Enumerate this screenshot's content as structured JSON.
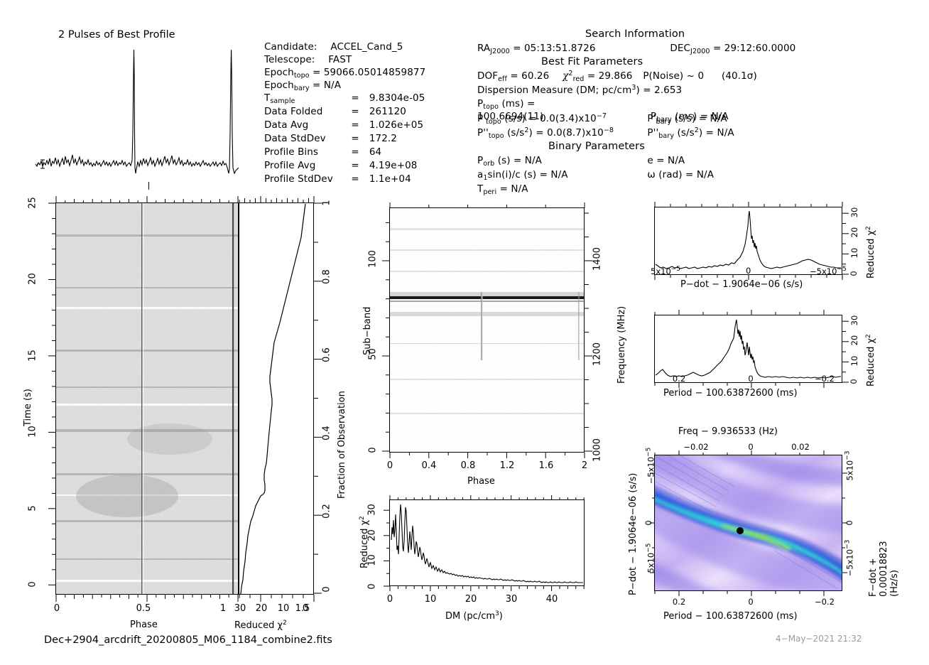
{
  "title_profile": "2 Pulses of Best Profile",
  "candidate_info": {
    "candidate_label": "Candidate:",
    "candidate_value": "ACCEL_Cand_5",
    "telescope_label": "Telescope:",
    "telescope_value": "FAST",
    "epoch_topo_label": "Epoch",
    "epoch_topo_sub": "topo",
    "epoch_topo_value": "59066.05014859877",
    "epoch_bary_label": "Epoch",
    "epoch_bary_sub": "bary",
    "epoch_bary_value": "N/A",
    "tsample_label": "T",
    "tsample_sub": "sample",
    "tsample_value": "9.8304e-05",
    "data_folded_label": "Data Folded",
    "data_folded_value": "261120",
    "data_avg_label": "Data Avg",
    "data_avg_value": "1.026e+05",
    "data_stddev_label": "Data StdDev",
    "data_stddev_value": "172.2",
    "profile_bins_label": "Profile Bins",
    "profile_bins_value": "64",
    "profile_avg_label": "Profile Avg",
    "profile_avg_value": "4.19e+08",
    "profile_stddev_label": "Profile StdDev",
    "profile_stddev_value": "1.1e+04"
  },
  "search_info": {
    "heading": "Search Information",
    "ra_label": "RA",
    "ra_sub": "J2000",
    "ra_value": "05:13:51.8726",
    "dec_label": "DEC",
    "dec_sub": "J2000",
    "dec_value": "29:12:60.0000",
    "bestfit_heading": "Best Fit Parameters",
    "dof_label": "DOF",
    "dof_sub": "eff",
    "dof_value": "60.26",
    "chi2_label": "χ",
    "chi2_sup": "2",
    "chi2_sub": "red",
    "chi2_value": "29.866",
    "pnoise_label": "P(Noise) ~",
    "pnoise_value": "0",
    "sigma_value": "(40.1σ)",
    "dm_label": "Dispersion Measure (DM; pc/cm",
    "dm_sup": "3",
    "dm_tail": ") =",
    "dm_value": "2.653",
    "ptopo_label": "P",
    "ptopo_sub": "topo",
    "ptopo_units": "(ms) =",
    "ptopo_value": "100.6694(11)",
    "pdot_topo_label": "P'",
    "pdot_topo_sub": "topo",
    "pdot_topo_units": "(s/s) =",
    "pdot_topo_value": "0.0(3.4)x10",
    "pdot_topo_exp": "−7",
    "pddot_topo_label": "P''",
    "pddot_topo_sub": "topo",
    "pddot_topo_units": "(s/s",
    "pddot_topo_units_sup": "2",
    "pddot_topo_units_tail": ") =",
    "pddot_topo_value": "0.0(8.7)x10",
    "pddot_topo_exp": "−8",
    "pbary_label": "P",
    "pbary_sub": "bary",
    "pbary_units": "(ms) =",
    "pbary_value": "N/A",
    "pdot_bary_label": "P'",
    "pdot_bary_sub": "bary",
    "pdot_bary_units": "(s/s) =",
    "pdot_bary_value": "N/A",
    "pddot_bary_label": "P''",
    "pddot_bary_sub": "bary",
    "pddot_bary_units": "(s/s",
    "pddot_bary_units_sup": "2",
    "pddot_bary_units_tail": ") =",
    "pddot_bary_value": "N/A"
  },
  "binary_info": {
    "heading": "Binary Parameters",
    "porb_label": "P",
    "porb_sub": "orb",
    "porb_units": "(s) =",
    "porb_value": "N/A",
    "asini_label": "a",
    "asini_sub": "1",
    "asini_units": "sin(i)/c (s) =",
    "asini_value": "N/A",
    "tperi_label": "T",
    "tperi_sub": "peri",
    "tperi_units": "=",
    "tperi_value": "N/A",
    "e_label": "e =",
    "e_value": "N/A",
    "omega_label": "ω (rad) =",
    "omega_value": "N/A"
  },
  "chart_data": [
    {
      "type": "line",
      "name": "best-profile",
      "title": "2 Pulses of Best Profile",
      "xlabel": "",
      "ylabel": "",
      "xlim": [
        0,
        2
      ],
      "ylim": [
        -0.15,
        1.05
      ],
      "grid": false,
      "note": "Folded pulse profile, two rotations; sharp narrow pulse at phase ~0.95 and ~1.95",
      "peak_phases": [
        0.95,
        1.95
      ],
      "peak_height": 1.0,
      "baseline_noise_rms": 0.03
    },
    {
      "type": "heatmap",
      "name": "time-vs-phase",
      "xlabel": "Phase",
      "ylabel": "Time (s)",
      "right_ylabel": "Fraction of Observation",
      "xlim": [
        0,
        2
      ],
      "ylim": [
        0,
        25.7
      ],
      "xticks": [
        0,
        0.5,
        1,
        1.5
      ],
      "xtick_labels": [
        "0",
        "0.5",
        "1",
        "1.5"
      ],
      "yticks": [
        0,
        5,
        10,
        15,
        20,
        25
      ],
      "ytick_labels": [
        "0",
        "5",
        "10",
        "15",
        "20",
        "25"
      ],
      "right_yticks": [
        0,
        0.2,
        0.4,
        0.6,
        0.8,
        1
      ],
      "right_ytick_labels": [
        "0",
        "0.2",
        "0.4",
        "0.6",
        "0.8",
        "1"
      ],
      "colormap": "greyscale",
      "grid": false
    },
    {
      "type": "line",
      "name": "cumulative-chi2-vs-time",
      "xlabel": "Reduced χ²",
      "xticks": [
        30,
        20,
        10,
        0
      ],
      "xtick_labels": [
        "30",
        "20",
        "10",
        "0"
      ],
      "xlim": [
        30,
        0
      ],
      "ylim": [
        0,
        1
      ],
      "grid": false,
      "note": "Cumulative reduced chi-squared rising with fraction of observation"
    },
    {
      "type": "heatmap",
      "name": "subband-vs-phase",
      "xlabel": "Phase",
      "ylabel": "Sub-band",
      "right_ylabel": "Frequency (MHz)",
      "xlim": [
        0,
        2
      ],
      "ylim": [
        0,
        128
      ],
      "xticks": [
        0,
        0.4,
        0.8,
        1.2,
        1.6,
        2
      ],
      "xtick_labels": [
        "0",
        "0.4",
        "0.8",
        "1.2",
        "1.6",
        "2"
      ],
      "yticks": [
        0,
        50,
        100
      ],
      "ytick_labels": [
        "0",
        "50",
        "100"
      ],
      "right_yticks": [
        1000,
        1200,
        1400
      ],
      "right_ytick_labels": [
        "1000",
        "1200",
        "1400"
      ],
      "colormap": "greyscale",
      "grid": false,
      "note": "Bright narrow horizontal band near sub-band ~68; vertical signal streak at phase ~0.95"
    },
    {
      "type": "line",
      "name": "chi2-vs-dm",
      "xlabel": "DM (pc/cm³)",
      "ylabel": "Reduced χ²",
      "xlim": [
        0,
        48
      ],
      "ylim": [
        0,
        33
      ],
      "xticks": [
        0,
        10,
        20,
        30,
        40
      ],
      "xtick_labels": [
        "0",
        "10",
        "20",
        "30",
        "40"
      ],
      "yticks": [
        0,
        10,
        20,
        30
      ],
      "ytick_labels": [
        "0",
        "10",
        "20",
        "30"
      ],
      "grid": false,
      "x": [
        0,
        0.7,
        1.2,
        1.7,
        2.2,
        2.7,
        3.2,
        3.7,
        4.2,
        4.7,
        5.2,
        5.8,
        6.3,
        7,
        8,
        9,
        10,
        11,
        12,
        13,
        14,
        15,
        16,
        17,
        18,
        19,
        20,
        21,
        22,
        24,
        26,
        28,
        30,
        32,
        34,
        36,
        38,
        40,
        42,
        44,
        46,
        48
      ],
      "values": [
        18,
        22,
        13,
        10,
        30,
        28,
        12,
        29,
        22,
        11,
        20,
        19,
        12,
        9,
        11,
        10,
        8.5,
        7.5,
        7,
        6.5,
        6,
        5.5,
        5,
        4.6,
        4.4,
        4,
        3.8,
        3.6,
        3.4,
        3.2,
        3.2,
        3,
        3,
        2.8,
        2.6,
        2.5,
        2.4,
        2.4,
        2.3,
        2.3,
        2.2,
        2.2
      ]
    },
    {
      "type": "line",
      "name": "chi2-vs-pdot",
      "xlabel": "P−dot − 1.9064e−06 (s/s)",
      "ylabel": "Reduced χ²",
      "xlim": [
        6e-05,
        -6e-05
      ],
      "ylim": [
        0,
        33
      ],
      "xticks": [
        "5x10−5",
        "0",
        "−5x10−5"
      ],
      "yticks": [
        0,
        10,
        20,
        30
      ],
      "ytick_labels": [
        "0",
        "10",
        "20",
        "30"
      ],
      "grid": false
    },
    {
      "type": "line",
      "name": "chi2-vs-period",
      "xlabel": "Period − 100.63872600 (ms)",
      "ylabel": "Reduced χ²",
      "xlim": [
        0.33,
        -0.33
      ],
      "ylim": [
        0,
        33
      ],
      "xticks": [
        0.2,
        0,
        -0.2
      ],
      "xtick_labels": [
        "0.2",
        "0",
        "−0.2"
      ],
      "yticks": [
        0,
        10,
        20,
        30
      ],
      "ytick_labels": [
        "0",
        "10",
        "20",
        "30"
      ],
      "grid": false
    },
    {
      "type": "heatmap",
      "name": "pdot-vs-period",
      "title": "Freq − 9.936533 (Hz)",
      "xlabel": "Period − 100.63872600 (ms)",
      "ylabel": "P−dot − 1.9064e−06 (s/s)",
      "right_ylabel": "F−dot + 0.00018823 (Hz/s)",
      "top_xticks": [
        "−0.02",
        "0",
        "0.02"
      ],
      "xticks": [
        "0.2",
        "0",
        "−0.2"
      ],
      "yticks": [
        "−5x10⁻⁵",
        "0",
        "5x10⁻⁵"
      ],
      "right_yticks": [
        "5x10⁻³",
        "0",
        "−5x10⁻³"
      ],
      "colormap": "purple-blue-cyan-green",
      "grid": false,
      "best_marker": {
        "x": 0.04,
        "y": 0.0
      },
      "note": "Diagonal ridge of high power running top-left to bottom-right; black dot marks best candidate"
    }
  ],
  "axis_labels": {
    "time_s": "Time (s)",
    "phase": "Phase",
    "reduced_chi2": "Reduced χ",
    "reduced_chi2_sup": "2",
    "fraction_of_observation": "Fraction of Observation",
    "subband": "Sub−band",
    "frequency_mhz": "Frequency (MHz)",
    "dm_label": "DM (pc/cm",
    "dm_sup": "3",
    "dm_tail": ")",
    "pdot_axis": "P−dot − 1.9064e−06 (s/s)",
    "period_axis": "Period − 100.63872600 (ms)",
    "freq_axis": "Freq − 9.936533 (Hz)",
    "pdot_axis2": "P−dot − 1.9064e−06 (s/s)",
    "fdot_axis": "F−dot + 0.00018823 (Hz/s)",
    "period_axis2": "Period − 100.63872600 (ms)"
  },
  "ticks": {
    "time_y": [
      "25",
      "20",
      "15",
      "10",
      "5",
      "0"
    ],
    "phase_x": [
      "0",
      "0.5",
      "1",
      "1.5"
    ],
    "chi_x": [
      "30",
      "20",
      "10",
      "0"
    ],
    "frac_obs": [
      "1",
      "0.8",
      "0.6",
      "0.4",
      "0.2",
      "0"
    ],
    "subband_y": [
      "100",
      "50",
      "0"
    ],
    "freq_y": [
      "1400",
      "1200",
      "1000"
    ],
    "subphase_x": [
      "0",
      "0.4",
      "0.8",
      "1.2",
      "1.6",
      "2"
    ],
    "dm_x": [
      "0",
      "10",
      "20",
      "30",
      "40"
    ],
    "dm_y": [
      "30",
      "20",
      "10",
      "0"
    ],
    "chi_small_y": [
      "30",
      "20",
      "10",
      "0"
    ],
    "pdot_x": [
      "5x10",
      "0",
      "−5x10"
    ],
    "pdot_exp": "−5",
    "period_x": [
      "0.2",
      "0",
      "−0.2"
    ],
    "freq_top_x": [
      "−0.02",
      "0",
      "0.02"
    ],
    "pdot2_y": [
      "−5x10",
      "0",
      "5x10"
    ],
    "pdot2_exp": "−5",
    "fdot_y": [
      "5x10",
      "0",
      "−5x10"
    ],
    "fdot_exp": "−3",
    "period2_x": [
      "0.2",
      "0",
      "−0.2"
    ]
  },
  "footer": {
    "filename": "Dec+2904_arcdrift_20200805_M06_1184_combine2.fits",
    "timestamp": "4−May−2021 21:32"
  },
  "colors": {
    "ink": "#000000",
    "background": "#ffffff",
    "heatmap_low": "#f2e6fb",
    "heatmap_mid": "#8f7fe0",
    "heatmap_high": "#1f4fd8",
    "heatmap_peak": "#19d8d8",
    "heatmap_top": "#7fe84a",
    "footer_grey": "#9a9a9a"
  }
}
